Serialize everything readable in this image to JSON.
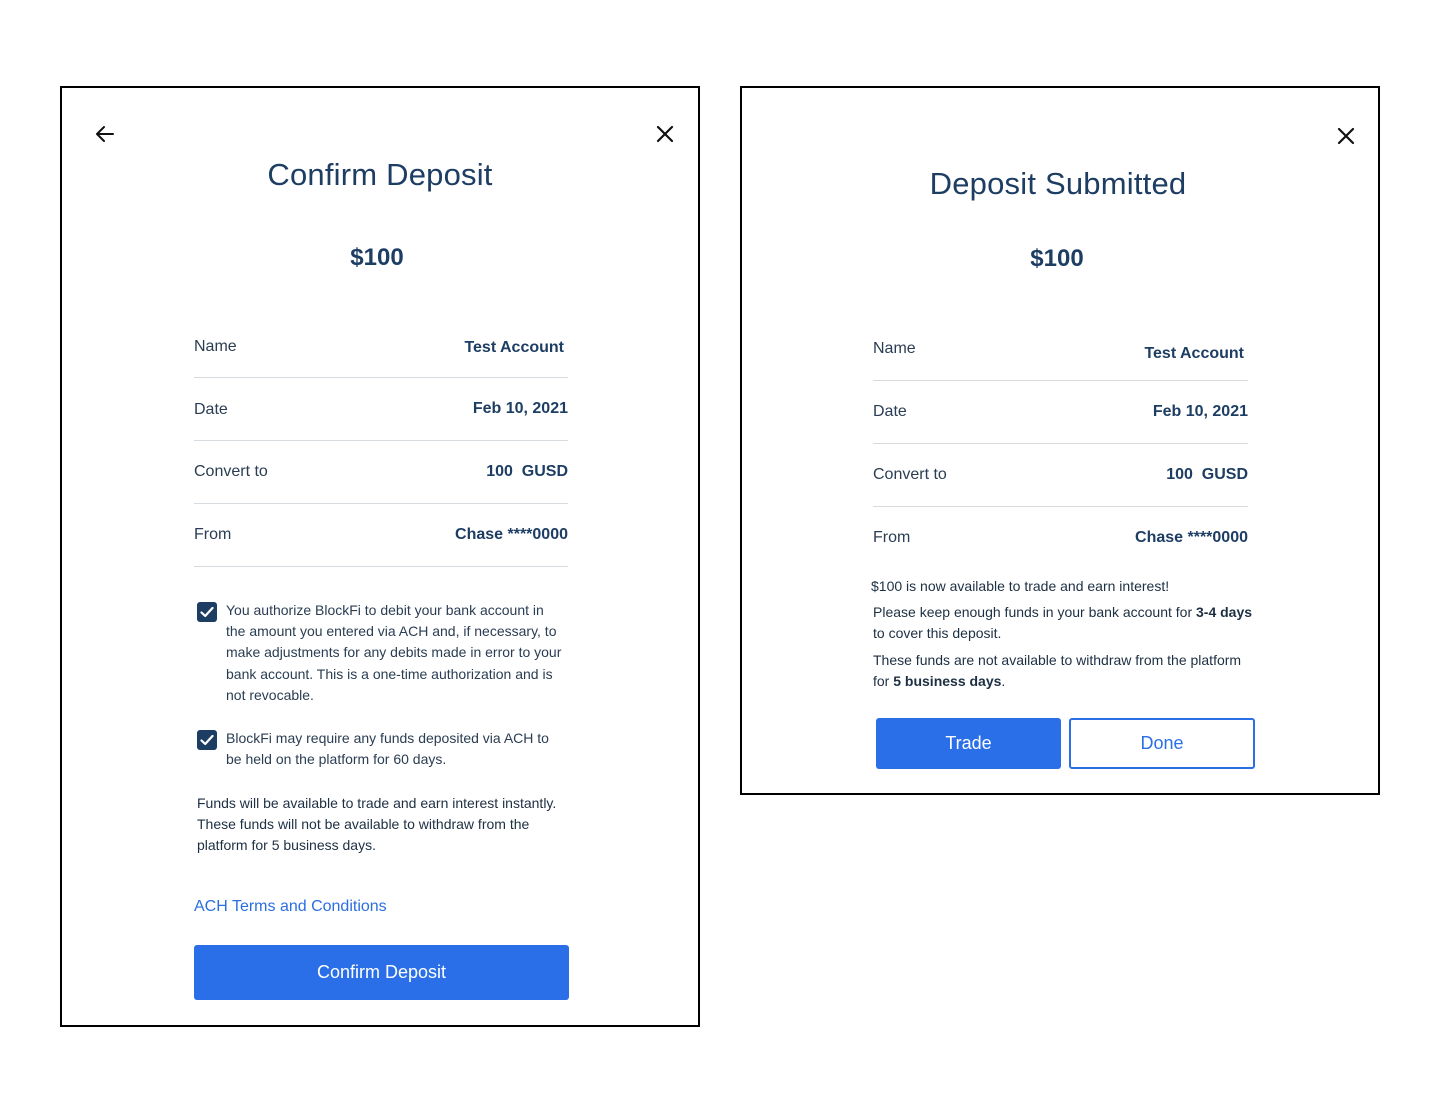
{
  "confirm": {
    "title": "Confirm Deposit",
    "amount": "$100",
    "rows": [
      {
        "label": "Name",
        "value": "Test Account"
      },
      {
        "label": "Date",
        "value": "Feb 10, 2021"
      },
      {
        "label": "Convert to",
        "value": "100  GUSD"
      },
      {
        "label": "From",
        "value": "Chase ****0000"
      }
    ],
    "checks": [
      {
        "checked": true,
        "text": "You authorize BlockFi to debit your bank account in the amount you entered via ACH and, if necessary, to make adjustments for any debits made in error to your bank account. This is a one-time authorization and is not revocable."
      },
      {
        "checked": true,
        "text": "BlockFi may require any funds deposited via ACH to be held on the platform for 60 days."
      }
    ],
    "notice": "Funds will be available to trade and earn interest instantly. These funds will not be available to withdraw from the platform for 5 business days.",
    "terms_link": "ACH Terms and Conditions",
    "confirm_button": "Confirm Deposit",
    "back_icon": "arrow-left-icon",
    "close_icon": "close-icon"
  },
  "submitted": {
    "title": "Deposit Submitted",
    "amount": "$100",
    "rows": [
      {
        "label": "Name",
        "value": "Test Account"
      },
      {
        "label": "Date",
        "value": "Feb 10, 2021"
      },
      {
        "label": "Convert to",
        "value": "100  GUSD"
      },
      {
        "label": "From",
        "value": "Chase ****0000"
      }
    ],
    "available_amount": "$100",
    "available_text": " is now available to trade and earn interest!",
    "keep_prefix": "Please keep enough funds in your bank account for ",
    "keep_bold": "3-4 days",
    "keep_suffix": " to cover this deposit.",
    "withdraw_prefix": "These funds are not available to withdraw from the platform for ",
    "withdraw_bold": "5 business days",
    "withdraw_suffix": ".",
    "trade_button": "Trade",
    "done_button": "Done",
    "close_icon": "close-icon"
  },
  "colors": {
    "primary": "#2a6fe8",
    "heading": "#1d3d63",
    "divider": "#d6dbe0"
  }
}
